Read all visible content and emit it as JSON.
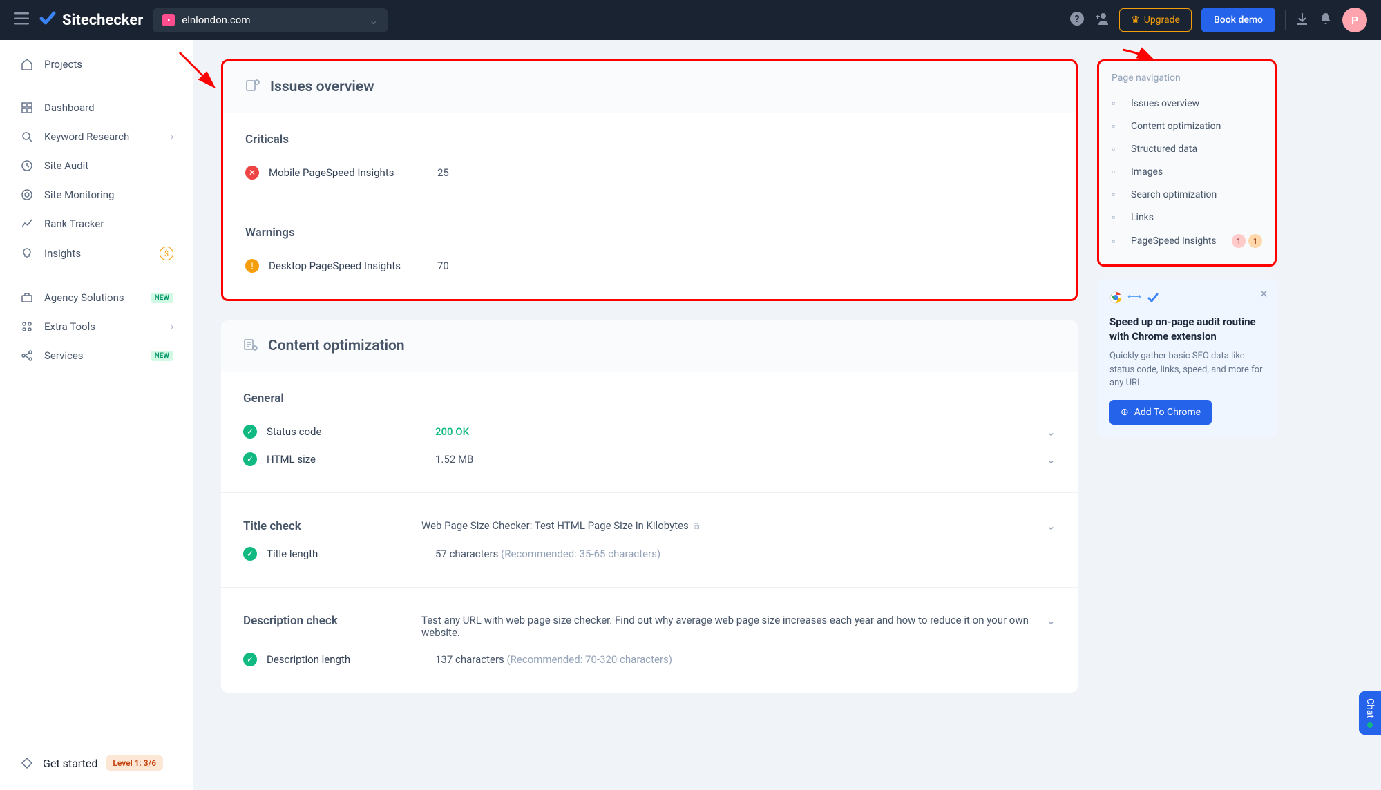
{
  "header": {
    "brand": "Sitechecker",
    "domain": "elnlondon.com",
    "upgrade": "Upgrade",
    "book_demo": "Book demo",
    "avatar": "P"
  },
  "sidebar": {
    "projects": "Projects",
    "items": [
      {
        "label": "Dashboard"
      },
      {
        "label": "Keyword Research",
        "chevron": true
      },
      {
        "label": "Site Audit"
      },
      {
        "label": "Site Monitoring"
      },
      {
        "label": "Rank Tracker"
      },
      {
        "label": "Insights",
        "insights_badge": true
      }
    ],
    "items2": [
      {
        "label": "Agency Solutions",
        "new": "NEW"
      },
      {
        "label": "Extra Tools",
        "chevron": true
      },
      {
        "label": "Services",
        "new": "NEW"
      }
    ],
    "get_started": "Get started",
    "level": "Level 1: 3/6"
  },
  "issues": {
    "title": "Issues overview",
    "criticals": {
      "title": "Criticals",
      "items": [
        {
          "label": "Mobile PageSpeed Insights",
          "value": "25"
        }
      ]
    },
    "warnings": {
      "title": "Warnings",
      "items": [
        {
          "label": "Desktop PageSpeed Insights",
          "value": "70"
        }
      ]
    }
  },
  "content_opt": {
    "title": "Content optimization",
    "general": {
      "title": "General",
      "status_label": "Status code",
      "status_value": "200 OK",
      "html_label": "HTML size",
      "html_value": "1.52 MB"
    },
    "title_check": {
      "title": "Title check",
      "snippet": "Web Page Size Checker: Test HTML Page Size in Kilobytes",
      "length_label": "Title length",
      "length_value": "57 characters",
      "length_rec": "(Recommended: 35-65 characters)"
    },
    "desc_check": {
      "title": "Description check",
      "snippet": "Test any URL with web page size checker. Find out why average web page size increases each year and how to reduce it on your own website.",
      "length_label": "Description length",
      "length_value": "137 characters",
      "length_rec": "(Recommended: 70-320 characters)"
    }
  },
  "nav": {
    "title": "Page navigation",
    "items": [
      "Issues overview",
      "Content optimization",
      "Structured data",
      "Images",
      "Search optimization",
      "Links",
      "PageSpeed Insights"
    ],
    "badge1": "1",
    "badge2": "1"
  },
  "promo": {
    "title": "Speed up on-page audit routine with Chrome extension",
    "desc": "Quickly gather basic SEO data like status code, links, speed, and more for any URL.",
    "cta": "Add To Chrome"
  },
  "chat": "Chat"
}
